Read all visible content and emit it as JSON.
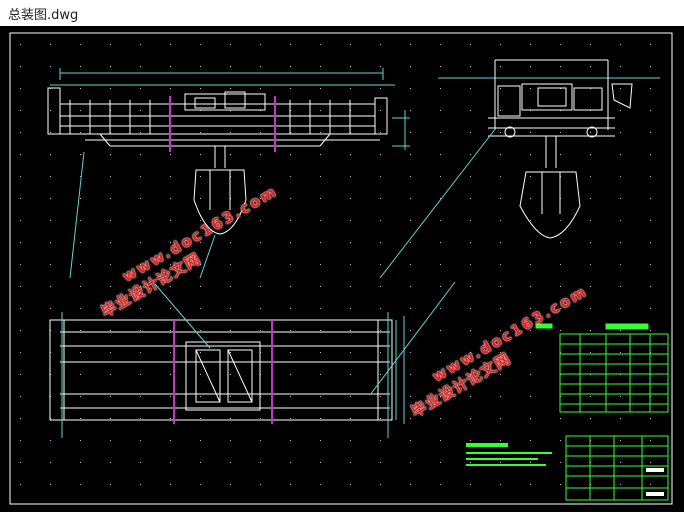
{
  "window": {
    "title": "总装图.dwg"
  },
  "watermarks": [
    {
      "line1": "毕业设计论文网",
      "line2": "www.doc163.com"
    },
    {
      "line1": "毕业设计论文网",
      "line2": "www.doc163.com"
    }
  ],
  "colors": {
    "background": "#000000",
    "structure": "#ffffff",
    "dimension": "#5fd3d3",
    "accent": "#c433c4",
    "table": "#33ff33",
    "watermark": "#e8211f"
  }
}
